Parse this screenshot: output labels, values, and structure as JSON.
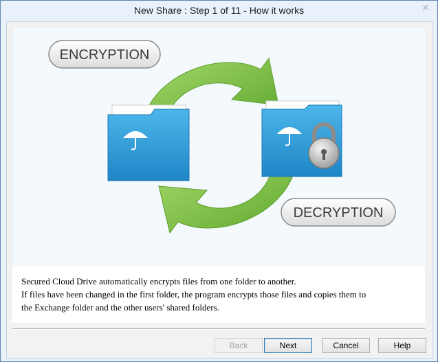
{
  "window": {
    "title": "New Share : Step 1 of 11 - How it works",
    "close_glyph": "✕"
  },
  "illustration": {
    "encryption_label": "ENCRYPTION",
    "decryption_label": "DECRYPTION",
    "arrow_color": "#7dc242",
    "folder_color": "#2e9fd8",
    "source_folder_icon": "umbrella-folder-icon",
    "target_folder_icon": "locked-umbrella-folder-icon",
    "lock_icon": "padlock-icon"
  },
  "description": {
    "line1": "Secured Cloud Drive automatically encrypts files from one folder to another.",
    "line2": "If files have been changed in the first folder, the program encrypts those files and copies them to",
    "line3": "the Exchange folder and the other users' shared folders."
  },
  "buttons": {
    "back": "Back",
    "next": "Next",
    "cancel": "Cancel",
    "help": "Help"
  }
}
